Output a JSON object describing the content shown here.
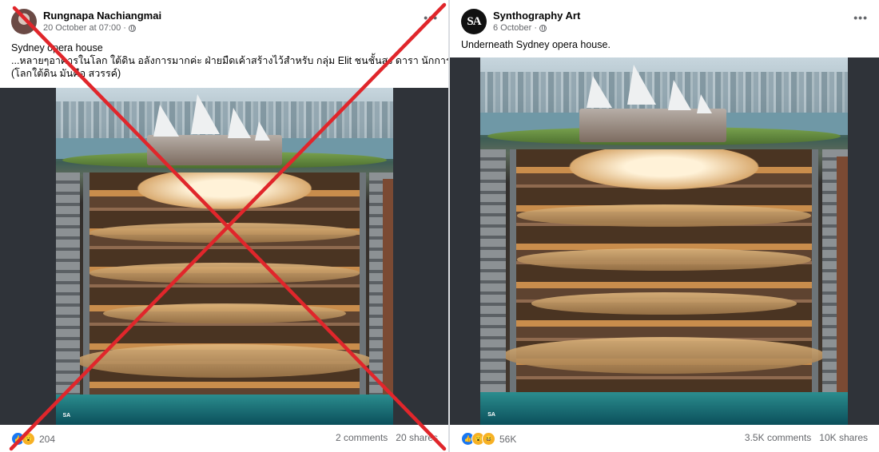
{
  "left_post": {
    "author": "Rungnapa Nachiangmai",
    "timestamp": "20 October at 07:00",
    "audience_icon": "globe-icon",
    "text_lines": [
      "Sydney opera house",
      "...หลายๆอาคารในโลก ใต้ดิน อลังการมากค่ะ ฝ่ายมืดเค้าสร้างไว้สำหรับ กลุ่ม Elit ชนชั้นสูง ดารา นักการเมือง",
      "(โลกใต้ดิน มันคือ สวรรค์)"
    ],
    "image_alt": "AI-generated cutaway of an underground complex beneath the Sydney Opera House",
    "watermark": "SA",
    "reactions": [
      "like",
      "wow"
    ],
    "reaction_count": "204",
    "comments": "2 comments",
    "shares": "20 shares",
    "overlay": "red-x-icon"
  },
  "right_post": {
    "author": "Synthography Art",
    "avatar_text": "SA",
    "timestamp": "6 October",
    "audience_icon": "globe-icon",
    "text": "Underneath Sydney opera house.",
    "image_alt": "AI-generated cutaway of an underground complex beneath the Sydney Opera House",
    "watermark": "SA",
    "reactions": [
      "like",
      "wow",
      "haha"
    ],
    "reaction_count": "56K",
    "comments": "3.5K comments",
    "shares": "10K shares"
  },
  "colors": {
    "cross": "#e0262b",
    "like": "#1877f2",
    "emoji": "#f7b125",
    "secondary_text": "#65676b"
  }
}
